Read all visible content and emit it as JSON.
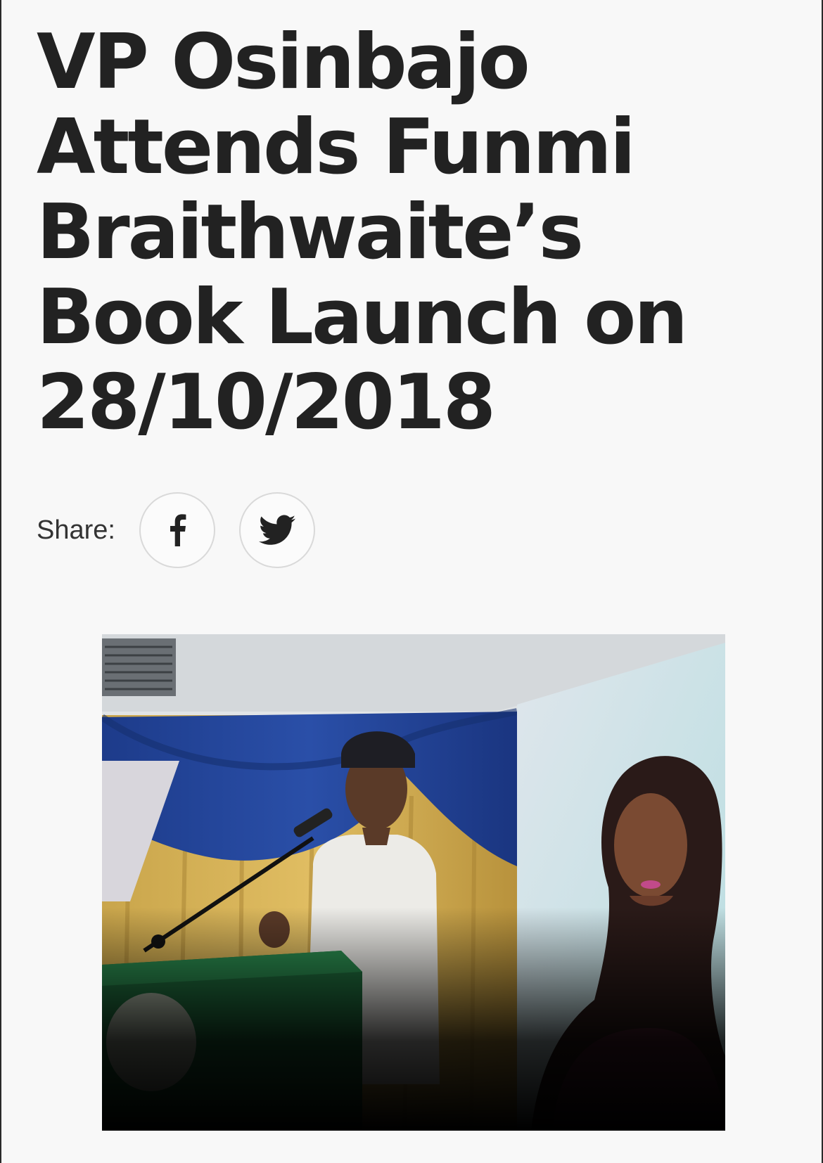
{
  "article": {
    "headline": "VP Osinbajo Attends Funmi Braithwaite’s Book Launch on 28/10/2018"
  },
  "share": {
    "label": "Share:",
    "buttons": [
      {
        "network": "facebook",
        "icon": "facebook-icon"
      },
      {
        "network": "twitter",
        "icon": "twitter-icon"
      }
    ]
  },
  "photo": {
    "subject": "vp-at-lectern-with-portrait-banner"
  },
  "colors": {
    "page_background": "#f8f8f8",
    "headline": "#222222",
    "share_label": "#333333",
    "share_border": "#d9d9d9"
  }
}
